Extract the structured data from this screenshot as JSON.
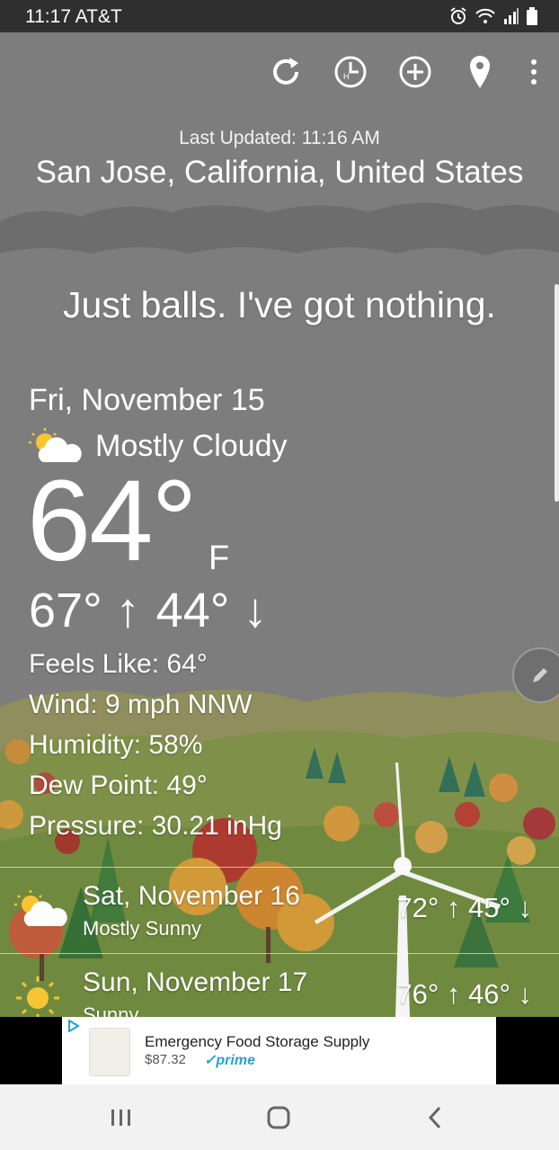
{
  "status": {
    "time_carrier": "11:17 AT&T"
  },
  "toolbar": {
    "icons": [
      "refresh-icon",
      "history-icon",
      "add-icon",
      "location-pin-icon",
      "more-vert-icon"
    ]
  },
  "header": {
    "last_updated": "Last Updated: 11:16 AM",
    "location": "San Jose, California, United States"
  },
  "quip": "Just balls. I've got nothing.",
  "current": {
    "date": "Fri, November 15",
    "condition": "Mostly Cloudy",
    "temp": "64°",
    "unit": "F",
    "high": "67° ↑",
    "low": "44° ↓",
    "feels_like": "Feels Like: 64°",
    "wind": "Wind: 9 mph NNW",
    "humidity": "Humidity: 58%",
    "dew_point": "Dew Point: 49°",
    "pressure": "Pressure: 30.21 inHg"
  },
  "forecast": [
    {
      "date": "Sat, November 16",
      "condition": "Mostly Sunny",
      "hilo": "72° ↑  45° ↓"
    },
    {
      "date": "Sun, November 17",
      "condition": "Sunny",
      "hilo": "76° ↑  46° ↓"
    }
  ],
  "ad": {
    "title": "Emergency Food Storage Supply",
    "price": "$87.32",
    "prime": "✓prime"
  }
}
